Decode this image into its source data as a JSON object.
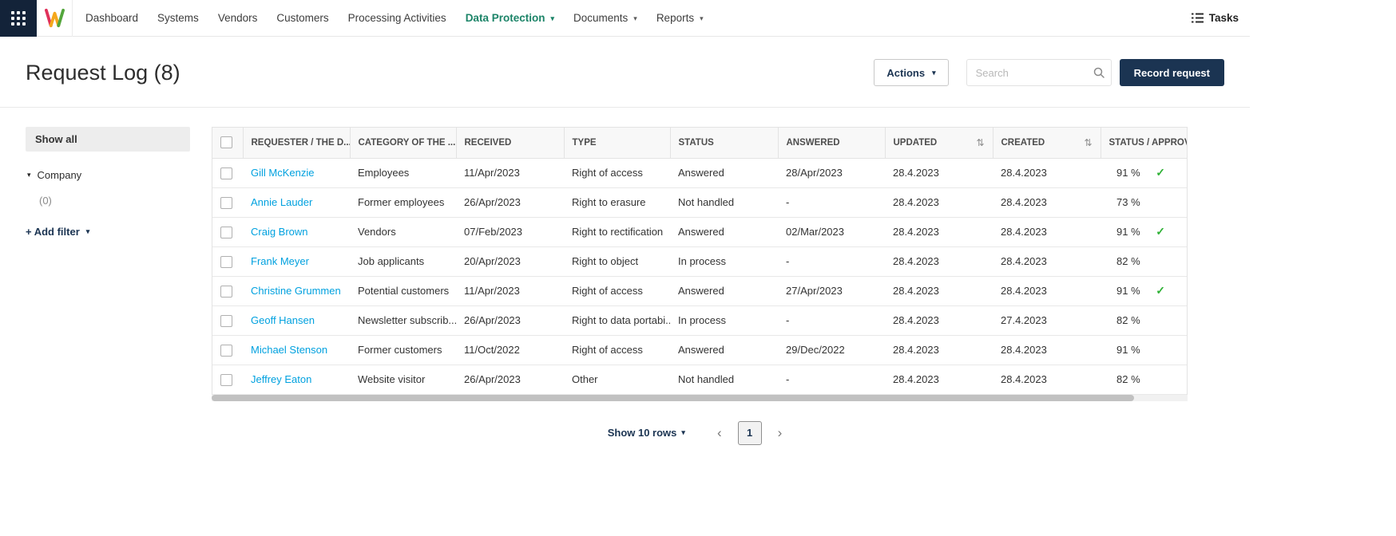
{
  "colors": {
    "tile": "#132339",
    "navy": "#1b3452",
    "teal": "#1c8468",
    "link": "#00a1df",
    "green": "#2eb135"
  },
  "icons": {
    "caret_down": "▾",
    "collapse_caret": "▾",
    "sort": "⇅",
    "check": "✓",
    "chevron_left": "‹",
    "chevron_right": "›"
  },
  "navbar": {
    "items": [
      {
        "label": "Dashboard",
        "dropdown": false,
        "active": false
      },
      {
        "label": "Systems",
        "dropdown": false,
        "active": false
      },
      {
        "label": "Vendors",
        "dropdown": false,
        "active": false
      },
      {
        "label": "Customers",
        "dropdown": false,
        "active": false
      },
      {
        "label": "Processing Activities",
        "dropdown": false,
        "active": false
      },
      {
        "label": "Data Protection",
        "dropdown": true,
        "active": true
      },
      {
        "label": "Documents",
        "dropdown": true,
        "active": false
      },
      {
        "label": "Reports",
        "dropdown": true,
        "active": false
      }
    ],
    "tasks_label": "Tasks"
  },
  "header": {
    "title": "Request Log (8)",
    "actions_label": "Actions",
    "search_placeholder": "Search",
    "record_button": "Record request"
  },
  "sidebar": {
    "show_all": "Show all",
    "company": "Company",
    "count": "(0)",
    "add_filter": "+ Add filter"
  },
  "table": {
    "columns": [
      "REQUESTER / THE D...",
      "CATEGORY OF THE ...",
      "RECEIVED",
      "TYPE",
      "STATUS",
      "ANSWERED",
      "UPDATED",
      "CREATED",
      "STATUS / APPROVAL"
    ],
    "rows": [
      {
        "requester": "Gill McKenzie",
        "category": "Employees",
        "received": "11/Apr/2023",
        "type": "Right of access",
        "status": "Answered",
        "answered": "28/Apr/2023",
        "updated": "28.4.2023",
        "created": "28.4.2023",
        "approval": "91 %",
        "approved": true
      },
      {
        "requester": "Annie Lauder",
        "category": "Former employees",
        "received": "26/Apr/2023",
        "type": "Right to erasure",
        "status": "Not handled",
        "answered": "-",
        "updated": "28.4.2023",
        "created": "28.4.2023",
        "approval": "73 %",
        "approved": false
      },
      {
        "requester": "Craig Brown",
        "category": "Vendors",
        "received": "07/Feb/2023",
        "type": "Right to rectification",
        "status": "Answered",
        "answered": "02/Mar/2023",
        "updated": "28.4.2023",
        "created": "28.4.2023",
        "approval": "91 %",
        "approved": true
      },
      {
        "requester": "Frank Meyer",
        "category": "Job applicants",
        "received": "20/Apr/2023",
        "type": "Right to object",
        "status": "In process",
        "answered": "-",
        "updated": "28.4.2023",
        "created": "28.4.2023",
        "approval": "82 %",
        "approved": false
      },
      {
        "requester": "Christine Grummen",
        "category": "Potential customers",
        "received": "11/Apr/2023",
        "type": "Right of access",
        "status": "Answered",
        "answered": "27/Apr/2023",
        "updated": "28.4.2023",
        "created": "28.4.2023",
        "approval": "91 %",
        "approved": true
      },
      {
        "requester": "Geoff Hansen",
        "category": "Newsletter subscrib...",
        "received": "26/Apr/2023",
        "type": "Right to data portabi...",
        "status": "In process",
        "answered": "-",
        "updated": "28.4.2023",
        "created": "27.4.2023",
        "approval": "82 %",
        "approved": false
      },
      {
        "requester": "Michael Stenson",
        "category": "Former customers",
        "received": "11/Oct/2022",
        "type": "Right of access",
        "status": "Answered",
        "answered": "29/Dec/2022",
        "updated": "28.4.2023",
        "created": "28.4.2023",
        "approval": "91 %",
        "approved": false
      },
      {
        "requester": "Jeffrey Eaton",
        "category": "Website visitor",
        "received": "26/Apr/2023",
        "type": "Other",
        "status": "Not handled",
        "answered": "-",
        "updated": "28.4.2023",
        "created": "28.4.2023",
        "approval": "82 %",
        "approved": false
      }
    ]
  },
  "pagination": {
    "rows_label": "Show 10 rows",
    "page": "1"
  }
}
